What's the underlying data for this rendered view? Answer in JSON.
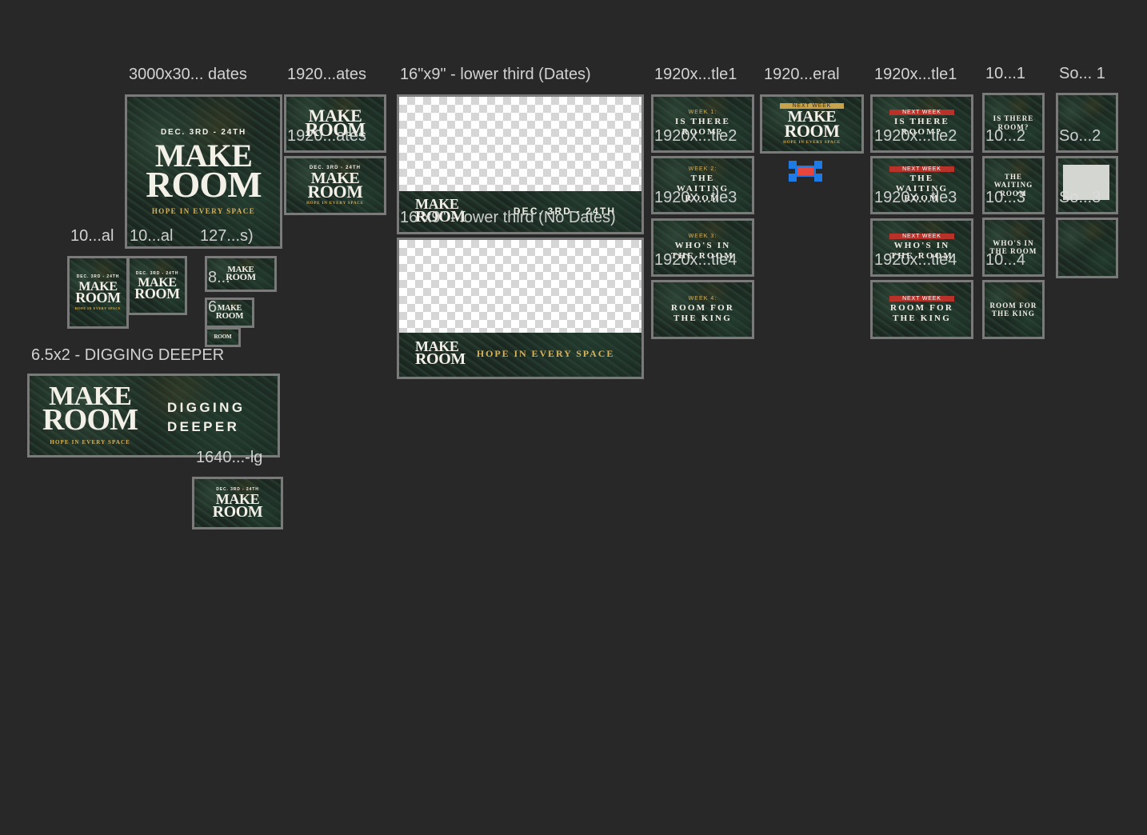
{
  "labels": {
    "main_dates": "3000x30... dates",
    "col2_top": "1920...ates",
    "col2_overlay": "1920...ates",
    "lower_third_dates": "16\"x9\" - lower third (Dates)",
    "lower_third_nodates": "16\"x9\" - lower third (No Dates)",
    "title1_a": "1920x...tle1",
    "general": "1920...eral",
    "title1_b": "1920x...tle1",
    "sq_1": "10...1",
    "so_1": "So... 1",
    "left_small": "10...al",
    "left_small2": "10...al",
    "small_127": "127...s)",
    "small_8": "8...",
    "small_6": "6",
    "digging_label": "6.5x2 - DIGGING DEEPER",
    "lg_label": "1640...-lg",
    "t2a": "1920x...tle2",
    "t3a": "1920x...tle3",
    "t4a": "1920x...tle4",
    "t2b": "1920x...tle2",
    "t3b": "1920x...tle3",
    "t4b": "1920x...tle4",
    "sq2": "10...2",
    "sq3": "10...3",
    "sq4": "10...4",
    "so2": "So...2",
    "so3": "So...3"
  },
  "art": {
    "dates": "DEC. 3RD - 24TH",
    "logo_line1": "MAKE",
    "logo_line2": "ROOM",
    "hope": "HOPE IN EVERY SPACE",
    "digging_line1": "DIGGING",
    "digging_line2": "DEEPER",
    "next_week": "NEXT WEEK",
    "lower_third_dates_text": "DEC. 3RD - 24TH"
  },
  "weeks": [
    {
      "label": "WEEK 1:",
      "title": "IS THERE ROOM?"
    },
    {
      "label": "WEEK 2:",
      "title": "THE WAITING ROOM"
    },
    {
      "label": "WEEK 3:",
      "title": "WHO'S IN THE ROOM"
    },
    {
      "label": "WEEK 4:",
      "title": "ROOM FOR THE KING"
    }
  ],
  "colors": {
    "canvas": "#282828",
    "artboard_border": "#7a7a7a",
    "label_text": "#d2d2d2",
    "gold": "#d8b25a",
    "next_week_red": "#b8322a",
    "selection_blue": "#1e7be6",
    "selection_red": "#e8453c"
  }
}
